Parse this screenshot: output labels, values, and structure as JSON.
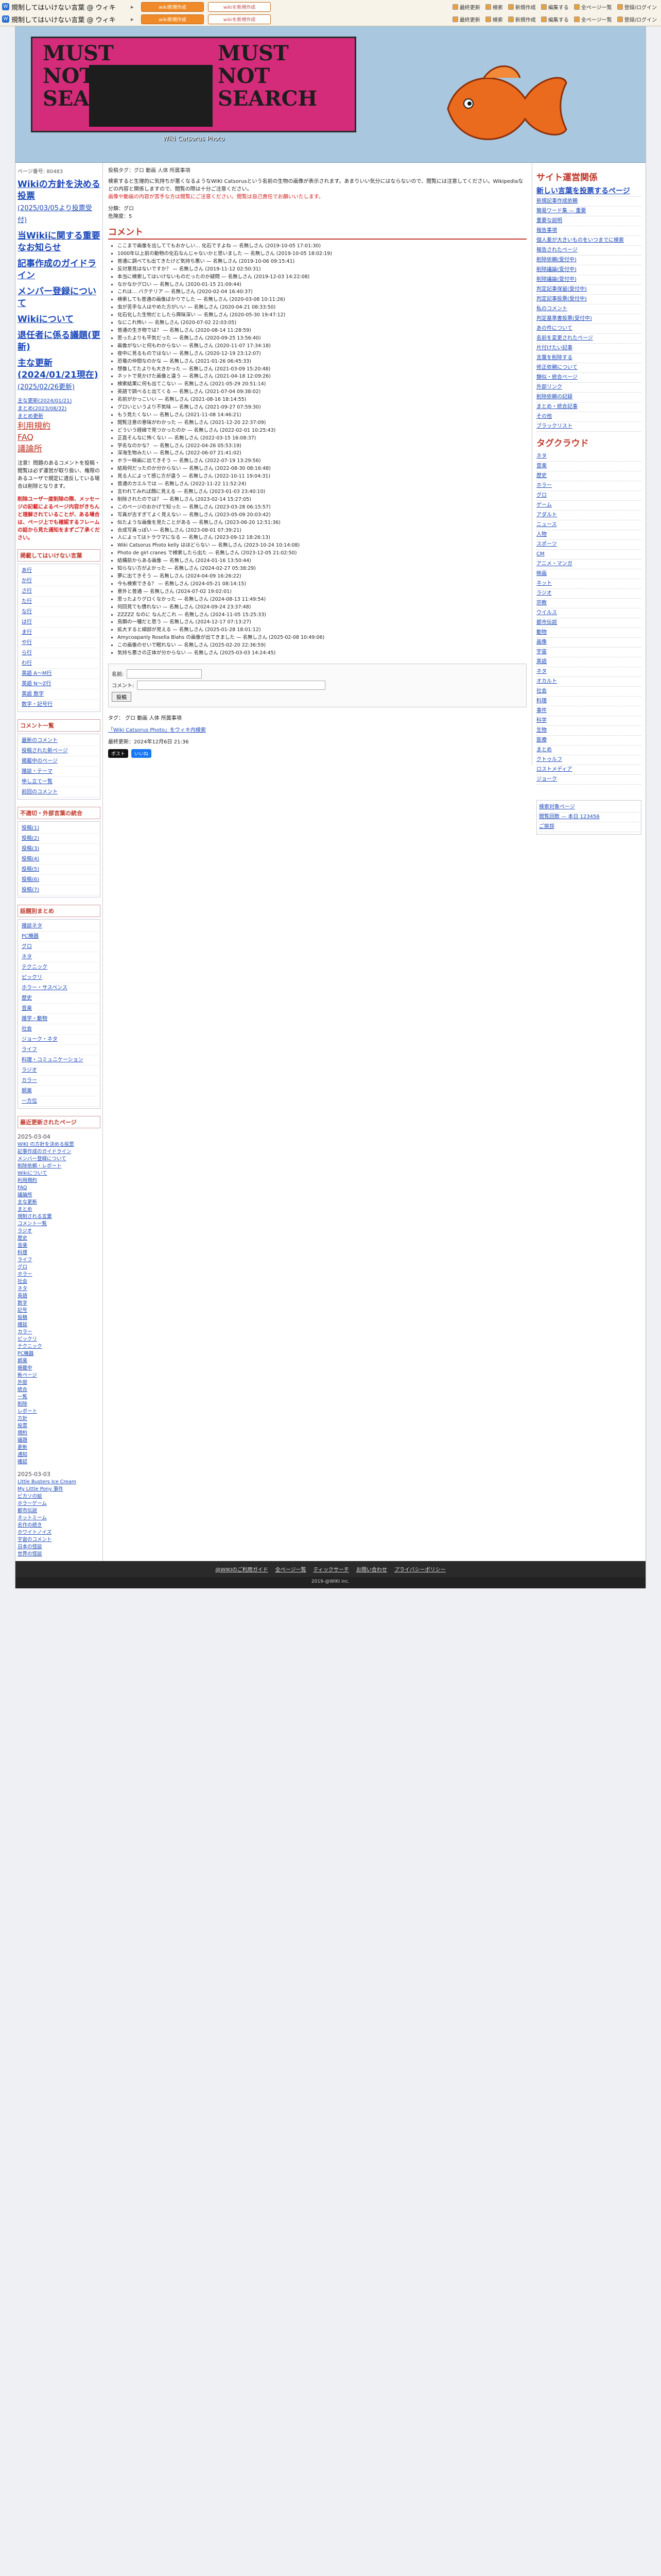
{
  "topbar": {
    "brand": "規制してはいけない言葉 @ ウィキ",
    "buttons": [
      "wiki新規作成",
      "wikiを新規作成"
    ],
    "links": [
      "最終更新",
      "検索",
      "新規作成",
      "編集する",
      "全ページ一覧",
      "登録/ログイン"
    ],
    "brand_color": "#2b6fd1",
    "accent": "#f08a28"
  },
  "header": {
    "logo_words": [
      "MUST",
      "NOT",
      "SEARCH",
      "MUST",
      "NOT",
      "SEARCH"
    ],
    "logo_sub": "Wiki Catsorus Photo"
  },
  "left": {
    "pageid": "ページ番号: 80483",
    "bignav": [
      {
        "label": "Wikiの方針を決める投票",
        "date": "(2025/03/05より投票受付)"
      },
      {
        "label": "当Wikiに関する重要なお知らせ",
        "date": ""
      },
      {
        "label": "記事作成のガイドライン",
        "date": ""
      },
      {
        "label": "メンバー登録について",
        "date": ""
      },
      {
        "label": "Wikiについて",
        "date": ""
      },
      {
        "label": "退任者に係る議題(更新)",
        "date": ""
      },
      {
        "label": "主な更新(2024/01/21現在)",
        "date": "(2025/02/26更新)"
      }
    ],
    "smalllinks": [
      "主な更新(2024/01/21)",
      "まとめ(2023/08/32)",
      "まとめ更新"
    ],
    "redbig": [
      "利用規約",
      "FAQ",
      "議論所"
    ],
    "warn1": "注意！問題のあるコメントを投稿・閲覧は必ず運営が取り扱い、権限のあるユーザで規定に違反している場合は削除となります。",
    "warn2": "削除ユーザ一度削除の際、メッセージの記載によるページ内容がきちんと理解されていることが、ある場合は、ページ上でも確認するフレームの話から見た通知をまずご了承ください。",
    "kana_title": "掲載してはいけない言葉",
    "kana": [
      "あ行",
      "か行",
      "さ行",
      "た行",
      "な行",
      "は行",
      "ま行",
      "や行",
      "ら行",
      "わ行",
      "英語 A〜M行",
      "英語 N〜Z行",
      "英語 数字",
      "数字・記号行"
    ],
    "comments_title": "コメント一覧",
    "comments_links": [
      "最新のコメント",
      "投稿された新ページ",
      "掲載中のページ",
      "雑談・テーマ",
      "申し立て一覧",
      "前回のコメント"
    ],
    "pending_title": "不適切・外部言葉の統合",
    "pending": [
      "投稿(1)",
      "投稿(2)",
      "投稿(3)",
      "投稿(4)",
      "投稿(5)",
      "投稿(6)",
      "投稿(7)"
    ],
    "topics_title": "話題別まとめ",
    "topics": [
      "雑談ネタ",
      "PC機器",
      "グロ",
      "ネタ",
      "テクニック",
      "ピックリ",
      "ホラー・サスペンス",
      "歴史",
      "音楽",
      "雑学・動物",
      "社会",
      "ジョーク・ネタ",
      "ライフ",
      "料理・コミュニケーション",
      "ラジオ",
      "カラー",
      "娯楽",
      "一方位"
    ],
    "recent_title": "最近更新されたページ",
    "recent_head": "2025-03-04",
    "recent": [
      "WIKI の方針を決める投票",
      "記事作成のガイドライン",
      "メンバー登録について",
      "削除依頼・レポート",
      "Wikiについて",
      "利用規約",
      "FAQ",
      "議論所",
      "主な更新",
      "まとめ",
      "規制される言葉",
      "コメント一覧",
      "ラジオ",
      "歴史",
      "音楽",
      "料理",
      "ライフ",
      "グロ",
      "ホラー",
      "社会",
      "ネタ",
      "英語",
      "数字",
      "記号",
      "投稿",
      "雑談",
      "カラー",
      "ピックリ",
      "テクニック",
      "PC機器",
      "娯楽",
      "掲載中",
      "新ページ",
      "外部",
      "統合",
      "一覧",
      "削除",
      "レポート",
      "方針",
      "投票",
      "規約",
      "議題",
      "更新",
      "通知",
      "確認"
    ],
    "recent_head2": "2025-03-03",
    "recent2": [
      "Little Busters Ice Cream",
      "My Little Pony 事件",
      "ピカソの絵",
      "ホラーゲーム",
      "都市伝説",
      "ネットミーム",
      "名作の続き",
      "ホワイトノイズ",
      "宇宙のコメント",
      "日本の怪談",
      "世界の怪談"
    ]
  },
  "main": {
    "crumb": "投稿タグ：グロ 動画 人体 所属事項",
    "intro": "検索すると生理的に気持ちが悪くなるようなWIKI Catsorusという名前の生物の画像が表示されます。あまりいい気分にはならないので、閲覧には注意してください。Wikipediaなどの内容と関係しますので、閲覧の際は十分ご注意ください。",
    "intro_red": "画像や動画の内容が苦手な方は閲覧にご注意ください。閲覧は自己責任でお願いいたします。",
    "meta": [
      "分類：グロ",
      "危険度：5"
    ],
    "section": "コメント",
    "comments": [
      "ここまで画像を出しててもおかしい… 化石ですよね — 名無しさん (2019-10-05 17:01:30)",
      "1000年以上前の動物の化石なんじゃないかと思いました — 名無しさん (2019-10-05 18:02:19)",
      "普通に調べても出てきたけど気持ち悪い — 名無しさん (2019-10-06 09:15:41)",
      "反対意見はないですか？ — 名無しさん (2019-11-12 02:50:31)",
      "本当に検索してはいけないものだったのか疑問 — 名無しさん (2019-12-03 14:22:08)",
      "なかなかグロい — 名無しさん (2020-01-15 21:09:44)",
      "これは… バクテリア — 名無しさん (2020-02-04 16:40:37)",
      "検索しても普通の画像ばかりでした — 名無しさん (2020-03-08 10:11:26)",
      "虫が苦手な人はやめた方がいい — 名無しさん (2020-04-21 08:33:50)",
      "化石化した生物だとしたら興味深い — 名無しさん (2020-05-30 19:47:12)",
      "なにこれ怖い — 名無しさん (2020-07-02 22:03:05)",
      "普通の生き物では？ — 名無しさん (2020-08-14 11:28:59)",
      "思ったよりも平気だった — 名無しさん (2020-09-25 13:56:40)",
      "画像がないと何もわからない — 名無しさん (2020-11-07 17:34:18)",
      "夜中に見るものではない — 名無しさん (2020-12-19 23:12:07)",
      "恐竜の仲間なのかな — 名無しさん (2021-01-26 06:45:33)",
      "想像してたよりも大きかった — 名無しさん (2021-03-09 15:20:48)",
      "ネットで見かけた画像と違う — 名無しさん (2021-04-18 12:09:26)",
      "検索結果に何も出てこない — 名無しさん (2021-05-29 20:51:14)",
      "英語で調べると出てくる — 名無しさん (2021-07-04 09:38:02)",
      "名前がかっこいい — 名無しさん (2021-08-16 18:14:55)",
      "グロいというより不気味 — 名無しさん (2021-09-27 07:59:30)",
      "もう見たくない — 名無しさん (2021-11-08 14:46:21)",
      "閲覧注意の意味がわかった — 名無しさん (2021-12-20 22:37:09)",
      "どういう経緯で見つかったのか — 名無しさん (2022-02-01 10:25:43)",
      "正直そんなに怖くない — 名無しさん (2022-03-15 16:08:37)",
      "学名なのかな？ — 名無しさん (2022-04-26 05:53:19)",
      "深海生物みたい — 名無しさん (2022-06-07 21:41:02)",
      "ホラー映画に出てきそう — 名無しさん (2022-07-19 13:29:56)",
      "結局何だったのか分からない — 名無しさん (2022-08-30 08:16:48)",
      "見る人によって感じ方が違う — 名無しさん (2022-10-11 19:04:31)",
      "普通のカエルでは — 名無しさん (2022-11-22 11:52:24)",
      "言われてみれば顔に見える — 名無しさん (2023-01-03 23:40:10)",
      "削除されたのでは？ — 名無しさん (2023-02-14 15:27:05)",
      "このページのおかげで知った — 名無しさん (2023-03-28 06:15:57)",
      "写真が古すぎてよく見えない — 名無しさん (2023-05-09 20:03:42)",
      "似たような画像を見たことがある — 名無しさん (2023-06-20 12:51:36)",
      "合成写真っぽい — 名無しさん (2023-08-01 07:39:21)",
      "人によってはトラウマになる — 名無しさん (2023-09-12 18:26:13)",
      "Wiki Catsorus Photo kelly はほどらない — 名無しさん (2023-10-24 10:14:08)",
      "Photo de girl cranes で検索したら出た — 名無しさん (2023-12-05 21:02:50)",
      "結構前からある画像 — 名無しさん (2024-01-16 13:50:44)",
      "知らない方がよかった — 名無しさん (2024-02-27 05:38:29)",
      "夢に出てきそう — 名無しさん (2024-04-09 16:26:22)",
      "今も検索できる？ — 名無しさん (2024-05-21 08:14:15)",
      "意外と普通 — 名無しさん (2024-07-02 19:02:01)",
      "思ったよりグロくなかった — 名無しさん (2024-08-13 11:49:54)",
      "何回見ても慣れない — 名無しさん (2024-09-24 23:37:48)",
      "ZZZZZ なのに なんだこれ — 名無しさん (2024-11-05 15:25:33)",
      "鳥類の一種だと思う — 名無しさん (2024-12-17 07:13:27)",
      "拡大すると細部が見える — 名無しさん (2025-01-28 18:01:12)",
      "Amycoapanly Rosella Blahs の画像が出てきました — 名無しさん (2025-02-08 10:49:06)",
      "この画像のせいで眠れない — 名無しさん (2025-02-20 22:36:59)",
      "気持ち悪さの正体が分からない — 名無しさん (2025-03-03 14:24:45)"
    ],
    "form_name": "名前:",
    "form_comment": "コメント:",
    "form_submit": "投稿",
    "tags": "タグ： グロ 動画 人体 所属事項",
    "related": "「Wiki Catsorus Photo」をウィキ内検索",
    "updated": "最終更新：2024年12月6日 21:36",
    "share": [
      "ポスト",
      "いいね"
    ]
  },
  "right": {
    "title1": "サイト運営関係",
    "bold_links": [
      "新しい言葉を投票するページ"
    ],
    "links1": [
      "新規記事作成依頼",
      "簡易ワード集 — 重要",
      "重要な説明",
      "報告事項",
      "個人差が大きいものをいつまでに検索",
      "報告されたページ",
      "削除依頼(受付中)",
      "削除議論(受付中)",
      "削除議論(受付中)",
      "判定記事保留(受付中)",
      "判定記事投票(受付中)",
      "私のコメント",
      "判定基準書投票(受付中)",
      "あの件について",
      "名前を変更されたページ",
      "片付けたい記事",
      "言葉を削除する",
      "修正依頼について",
      "類似・統合ページ",
      "外部リンク",
      "削除依頼の記録",
      "まとめ・統合記事",
      "その他",
      "ブラックリスト"
    ],
    "title2": "タグクラウド",
    "tags": [
      "ネタ",
      "音楽",
      "歴史",
      "ホラー",
      "グロ",
      "ゲーム",
      "アダルト",
      "ニュース",
      "人物",
      "スポーツ",
      "CM",
      "アニメ・マンガ",
      "映画",
      "ネット",
      "ラジオ",
      "宗教",
      "ウイルス",
      "都市伝説",
      "動物",
      "画像",
      "宇宙",
      "英語",
      "ネタ",
      "オカルト",
      "社会",
      "料理",
      "事件",
      "科学",
      "生物",
      "医療",
      "まとめ",
      "クトゥルフ",
      "ロストメディア",
      "ジョーク"
    ],
    "box": [
      "検索対象ページ",
      "閲覧回数 — 本日 123456",
      "ご挨拶"
    ]
  },
  "footer": {
    "links": [
      "@WIKIのご利用ガイド",
      "全ページ一覧",
      "ティックサーチ",
      "お問い合わせ",
      "プライバシーポリシー"
    ],
    "copy": "2019-@WIKI inc."
  }
}
